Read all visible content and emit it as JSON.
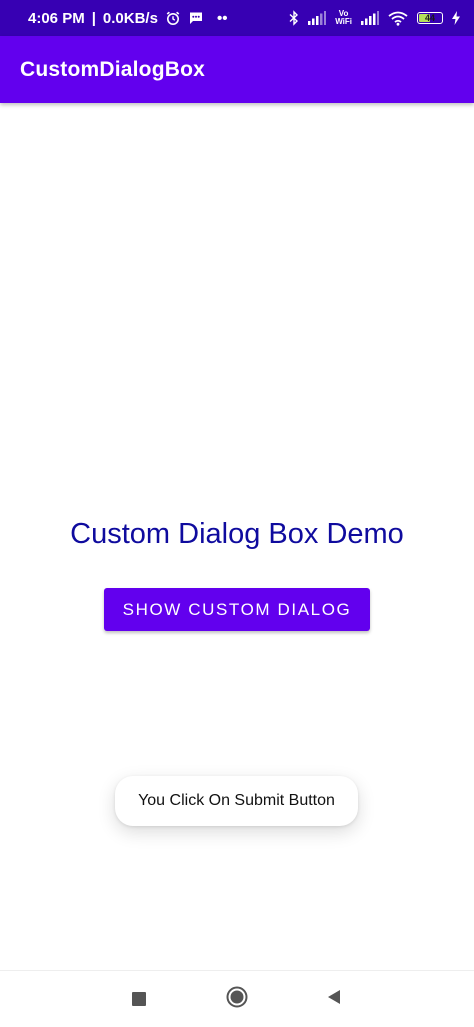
{
  "status_bar": {
    "time": "4:06 PM",
    "separator": "|",
    "network_speed": "0.0KB/s",
    "more": "••",
    "vowifi_top": "Vo",
    "vowifi_bottom": "WiFi",
    "battery_level": "44",
    "icons": [
      "alarm-icon",
      "message-icon",
      "bluetooth-icon",
      "signal-icon",
      "wifi-icon",
      "battery-icon",
      "charging-icon"
    ]
  },
  "app_bar": {
    "title": "CustomDialogBox"
  },
  "main": {
    "heading": "Custom Dialog Box Demo",
    "button_label": "SHOW CUSTOM DIALOG"
  },
  "toast": {
    "message": "You Click On Submit Button"
  },
  "nav_bar": {
    "icons": [
      "recents-icon",
      "home-icon",
      "back-icon"
    ]
  },
  "colors": {
    "status_bar": "#3700b3",
    "primary": "#6200ee",
    "heading_text": "#0f0b9e",
    "background": "#ffffff"
  }
}
